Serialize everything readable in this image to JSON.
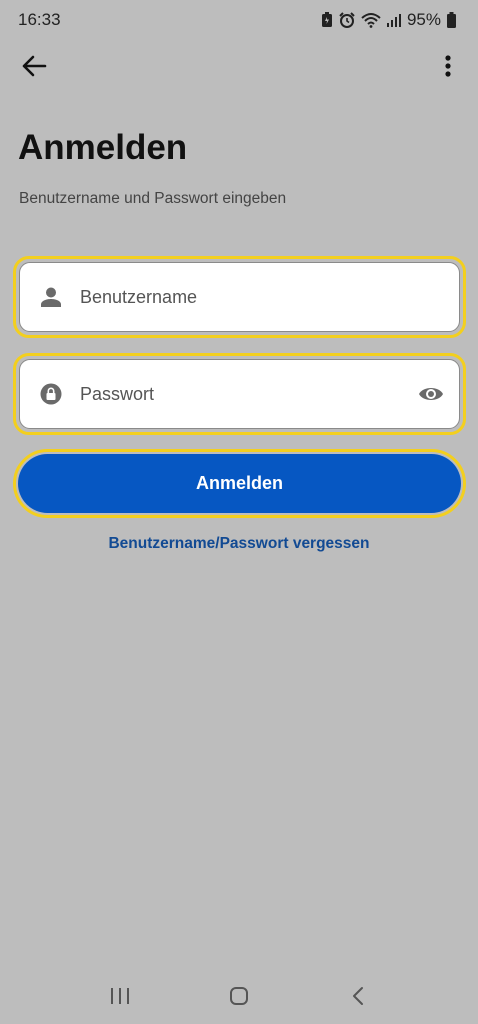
{
  "status_bar": {
    "time": "16:33",
    "battery": "95%",
    "icons": [
      "battery-saver-icon",
      "alarm-icon",
      "wifi-icon",
      "signal-icon",
      "battery-icon"
    ]
  },
  "top_bar": {
    "back_icon": "arrow-left-icon",
    "menu_icon": "more-vert-icon"
  },
  "page": {
    "title": "Anmelden",
    "subtitle": "Benutzername und Passwort eingeben"
  },
  "form": {
    "username": {
      "placeholder": "Benutzername",
      "icon": "person-icon"
    },
    "password": {
      "placeholder": "Passwort",
      "icon": "lock-icon",
      "toggle_icon": "eye-icon"
    },
    "submit_label": "Anmelden",
    "forgot_label": "Benutzername/Passwort vergessen"
  },
  "colors": {
    "background": "#bdbdbd",
    "accent": "#0657c2",
    "focus_ring": "#f3cf1e",
    "link": "#124a93"
  },
  "nav_bar": {
    "icons": [
      "recent-apps-icon",
      "home-icon",
      "back-nav-icon"
    ]
  }
}
